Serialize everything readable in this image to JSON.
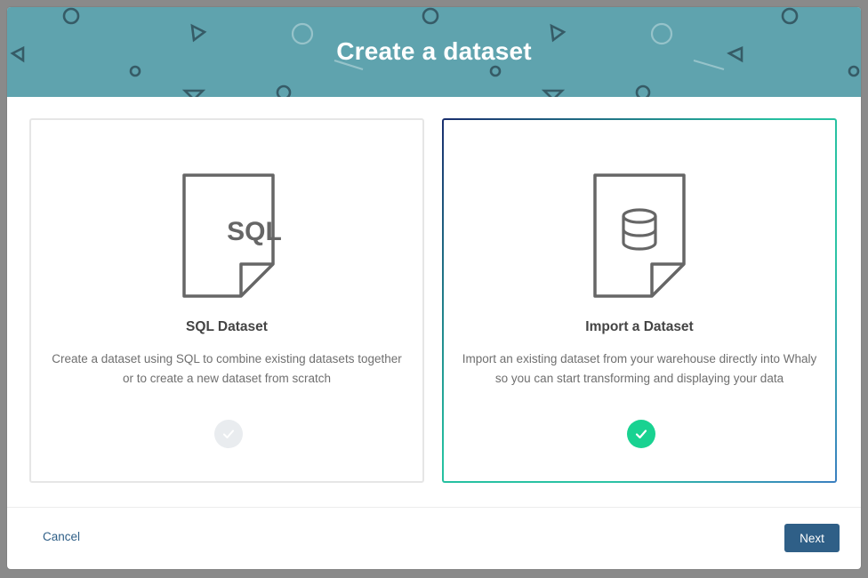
{
  "modal": {
    "title": "Create a dataset",
    "header_color": "#5fa3ae"
  },
  "cards": [
    {
      "id": "sql",
      "title": "SQL Dataset",
      "description": "Create a dataset using SQL to combine existing datasets together or to create a new dataset from scratch",
      "icon_label": "SQL",
      "icon": "sql-file-icon",
      "selected": false
    },
    {
      "id": "import",
      "title": "Import a Dataset",
      "description": "Import an existing dataset from your warehouse directly into Whaly so you can start transforming and displaying your data",
      "icon": "database-file-icon",
      "selected": true
    }
  ],
  "footer": {
    "cancel_label": "Cancel",
    "next_label": "Next"
  },
  "colors": {
    "primary": "#2f5f87",
    "success": "#19d291",
    "unselected_check": "#e9ecef"
  }
}
